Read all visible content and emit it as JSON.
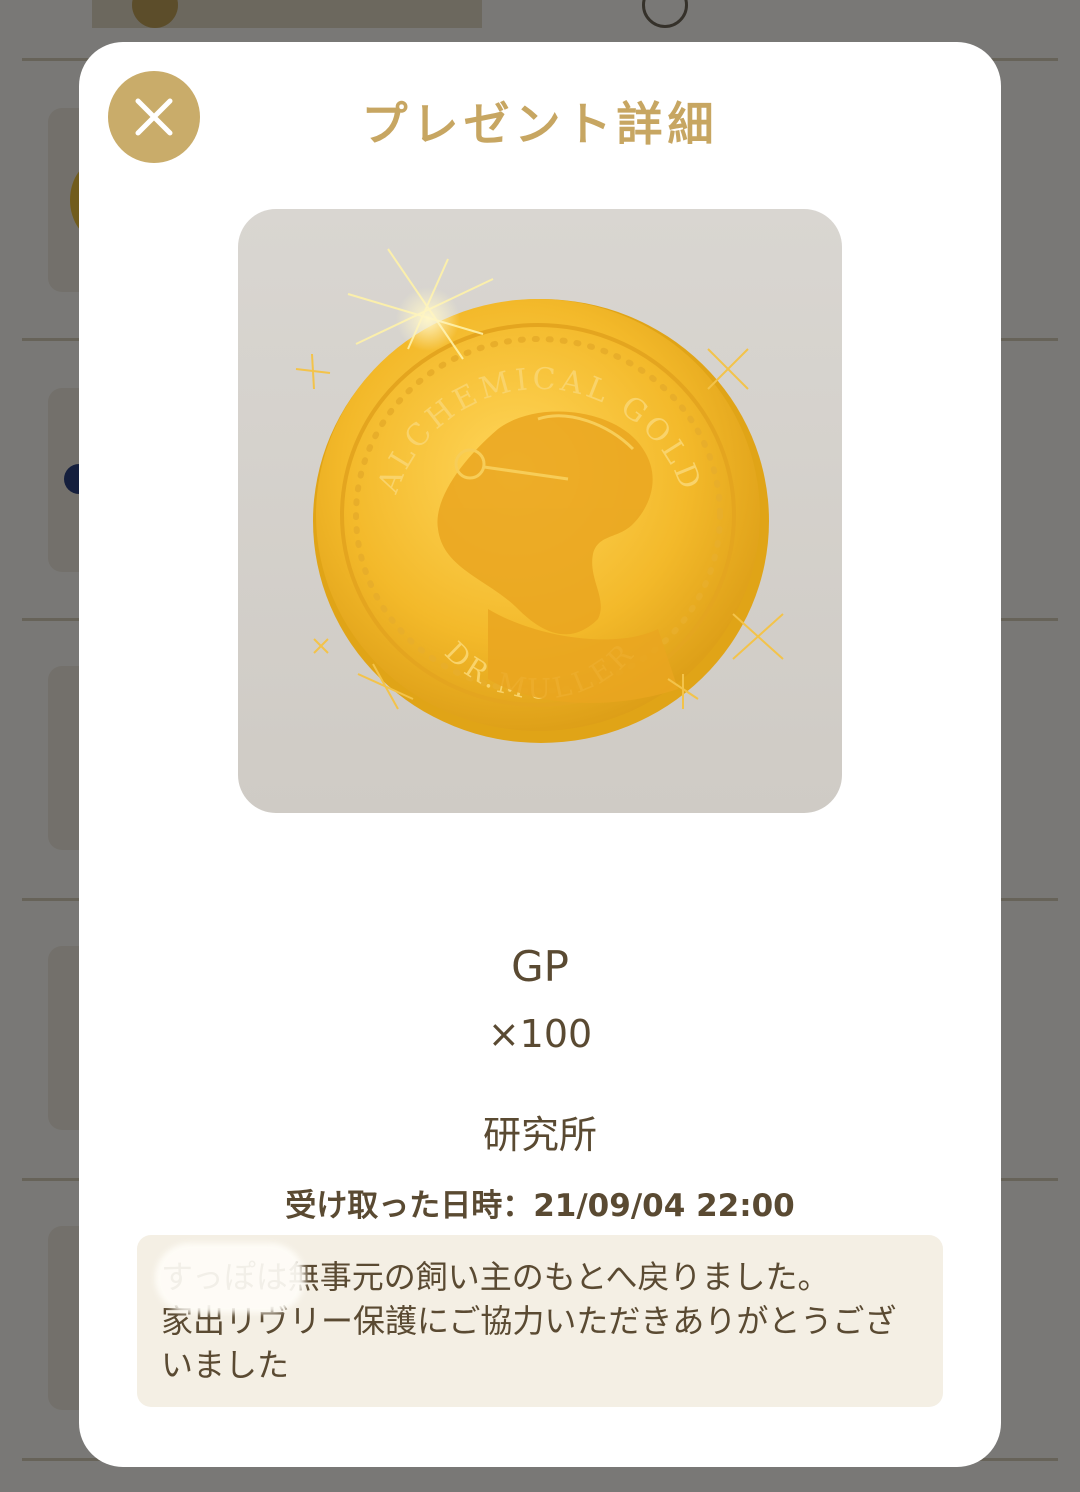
{
  "modal": {
    "title": "プレゼント詳細",
    "item_name": "GP",
    "quantity": "×100",
    "source": "研究所",
    "received_label": "受け取った日時：21/09/04 22:00",
    "message": "すっぽは無事元の飼い主のもとへ戻りました。\n家出リヴリー保護にご協力いただきありがとうございました",
    "close_icon": "close-icon"
  },
  "coin": {
    "top_inscription": "ALCHEMICAL GOLD",
    "bottom_inscription": "DR.MULLER"
  },
  "colors": {
    "accent_gold": "#c9ac6a",
    "title_gold": "#c7a662",
    "text_brown": "#5a4a32",
    "message_bg": "#f4efe4"
  }
}
